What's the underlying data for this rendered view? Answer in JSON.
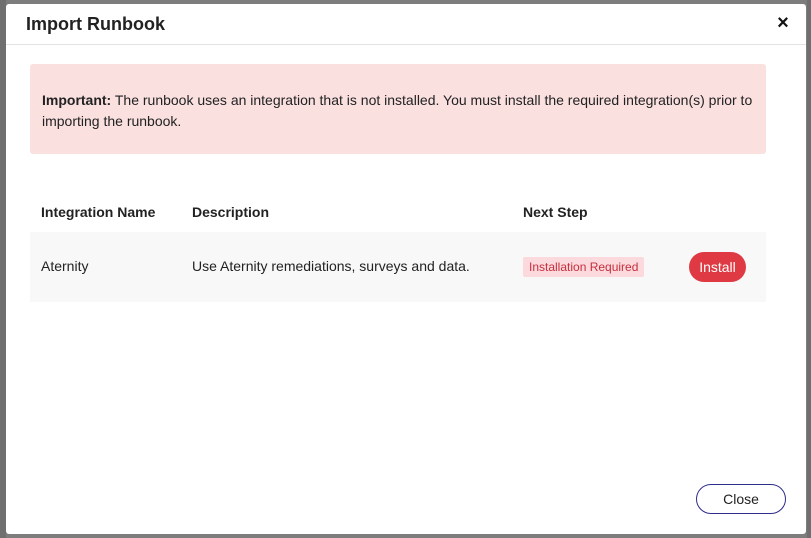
{
  "dialog": {
    "title": "Import Runbook",
    "close_icon": "close-icon",
    "close_glyph": "×"
  },
  "alert": {
    "label": "Important:",
    "message": " The runbook uses an integration that is not installed. You must install the required integration(s) prior to importing the runbook."
  },
  "table": {
    "columns": [
      "Integration Name",
      "Description",
      "Next Step"
    ],
    "rows": [
      {
        "name": "Aternity",
        "description": "Use Aternity remediations, surveys and data.",
        "status": "Installation Required",
        "action": "Install"
      }
    ]
  },
  "footer": {
    "close_label": "Close"
  },
  "colors": {
    "alert_bg": "#fbe0e0",
    "badge_bg": "#fbd9dc",
    "badge_text": "#c62f3d",
    "install_btn": "#df3a43",
    "close_btn_border": "#2d2d8c"
  }
}
